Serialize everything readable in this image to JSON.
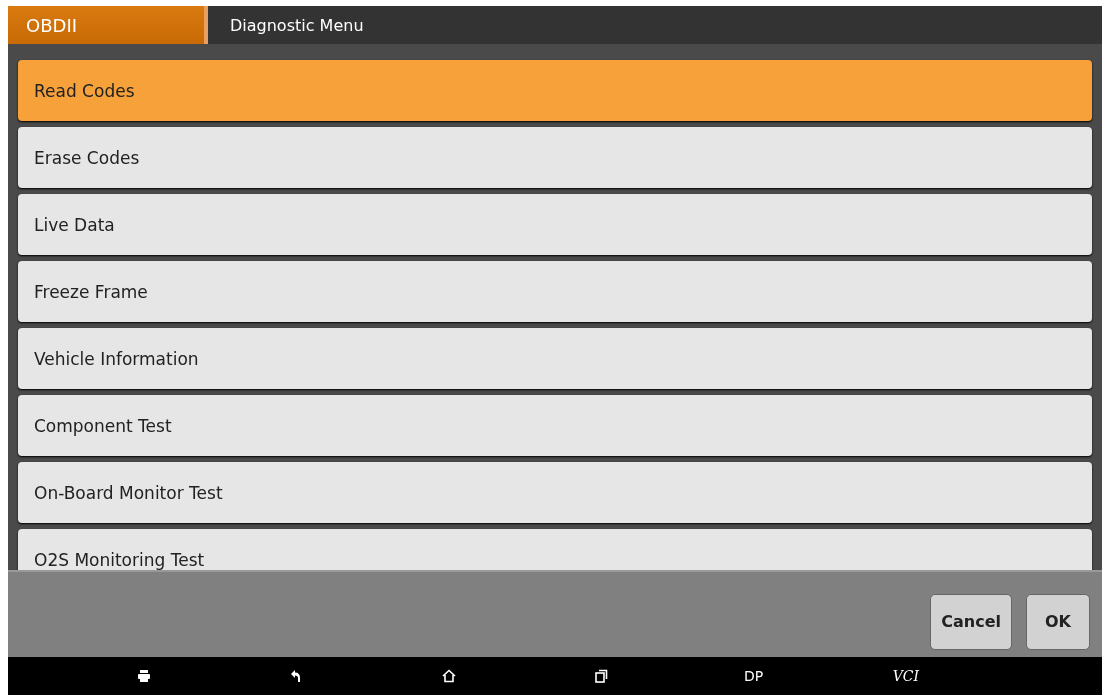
{
  "header": {
    "app": "OBDII",
    "title": "Diagnostic Menu"
  },
  "menu": [
    {
      "label": "Read Codes",
      "selected": true
    },
    {
      "label": "Erase Codes",
      "selected": false
    },
    {
      "label": "Live Data",
      "selected": false
    },
    {
      "label": "Freeze Frame",
      "selected": false
    },
    {
      "label": "Vehicle Information",
      "selected": false
    },
    {
      "label": "Component Test",
      "selected": false
    },
    {
      "label": "On-Board Monitor Test",
      "selected": false
    },
    {
      "label": "O2S Monitoring Test",
      "selected": false
    }
  ],
  "buttons": [
    "Cancel",
    "OK"
  ],
  "nav_bar": {
    "dp": "DP",
    "vci": "VCI"
  }
}
